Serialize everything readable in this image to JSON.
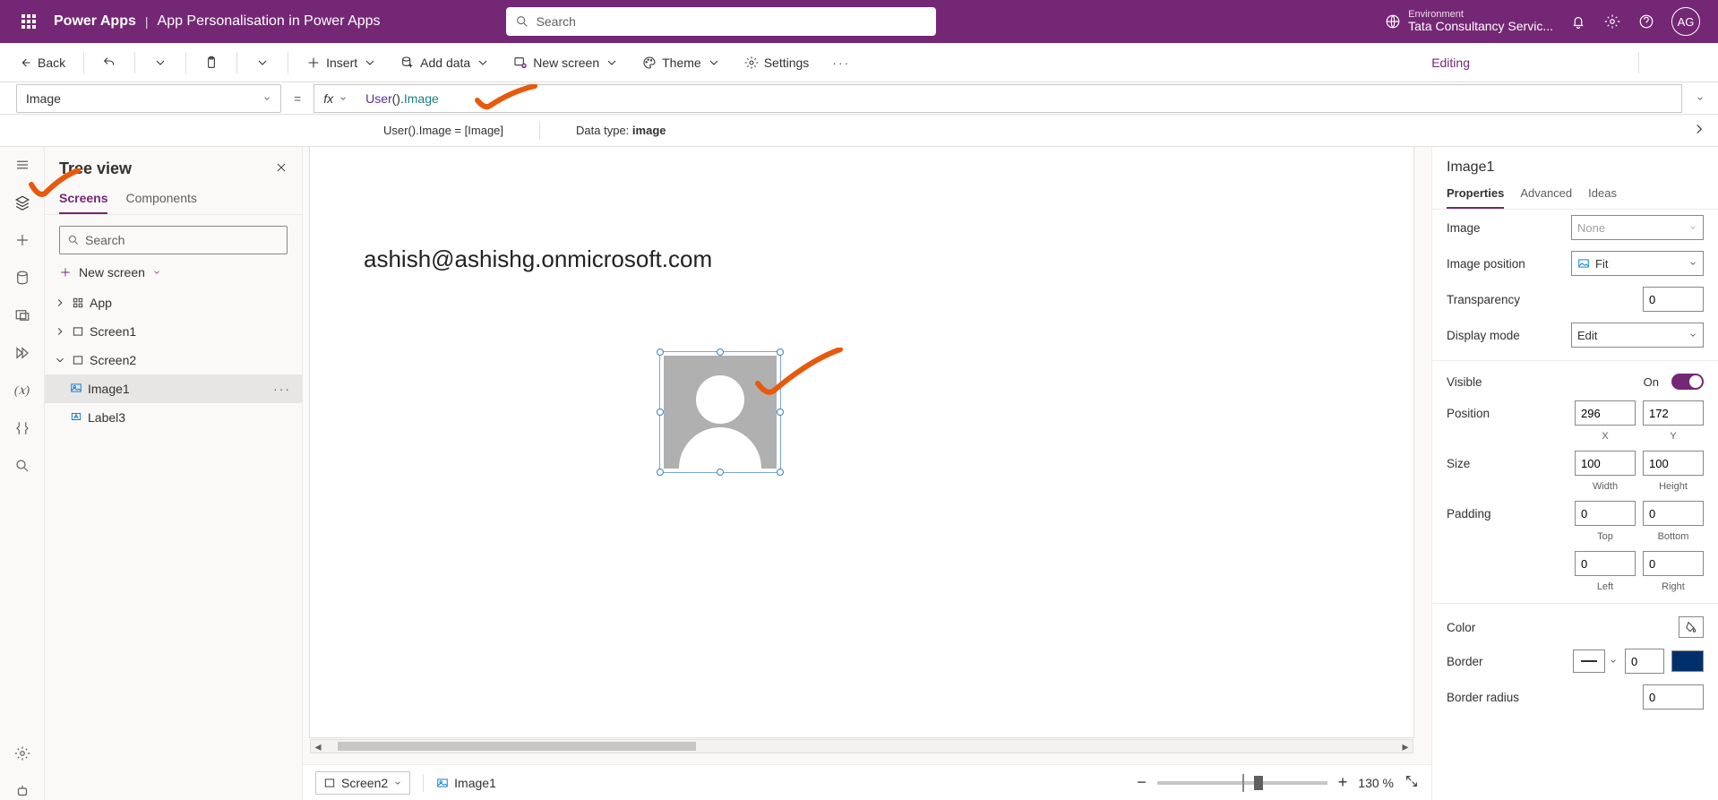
{
  "header": {
    "product": "Power Apps",
    "separator": "|",
    "appName": "App Personalisation in Power Apps",
    "searchPlaceholder": "Search",
    "envLabel": "Environment",
    "envName": "Tata Consultancy Servic...",
    "avatar": "AG"
  },
  "cmd": {
    "back": "Back",
    "insert": "Insert",
    "addData": "Add data",
    "newScreen": "New screen",
    "theme": "Theme",
    "settings": "Settings",
    "editing": "Editing"
  },
  "formula": {
    "property": "Image",
    "fx": "fx",
    "tokens": {
      "fn": "User",
      "paren": "()",
      "dot": ".",
      "prop": "Image"
    },
    "evalLeft": "User().Image  =  [Image]",
    "evalTypeLabel": "Data type:",
    "evalType": "image"
  },
  "tree": {
    "title": "Tree view",
    "tabs": {
      "screens": "Screens",
      "components": "Components"
    },
    "searchPlaceholder": "Search",
    "newScreen": "New screen",
    "items": {
      "app": "App",
      "screen1": "Screen1",
      "screen2": "Screen2",
      "image1": "Image1",
      "label3": "Label3"
    }
  },
  "canvas": {
    "email": "ashish@ashishg.onmicrosoft.com"
  },
  "footer": {
    "screen": "Screen2",
    "breadcrumb": "Image1",
    "zoomPct": "130 %"
  },
  "props": {
    "controlName": "Image1",
    "tabs": {
      "properties": "Properties",
      "advanced": "Advanced",
      "ideas": "Ideas"
    },
    "rows": {
      "image": "Image",
      "imagePlaceholder": "None",
      "imagePosition": "Image position",
      "imagePositionVal": "Fit",
      "transparency": "Transparency",
      "transparencyVal": "0",
      "displayMode": "Display mode",
      "displayModeVal": "Edit",
      "visible": "Visible",
      "onLabel": "On",
      "position": "Position",
      "posX": "296",
      "posY": "172",
      "xLabel": "X",
      "yLabel": "Y",
      "size": "Size",
      "width": "100",
      "height": "100",
      "widthLabel": "Width",
      "heightLabel": "Height",
      "padding": "Padding",
      "padTop": "0",
      "padBottom": "0",
      "padLeft": "0",
      "padRight": "0",
      "topLabel": "Top",
      "bottomLabel": "Bottom",
      "leftLabel": "Left",
      "rightLabel": "Right",
      "color": "Color",
      "border": "Border",
      "borderVal": "0",
      "borderRadius": "Border radius",
      "borderRadiusVal": "0"
    }
  }
}
